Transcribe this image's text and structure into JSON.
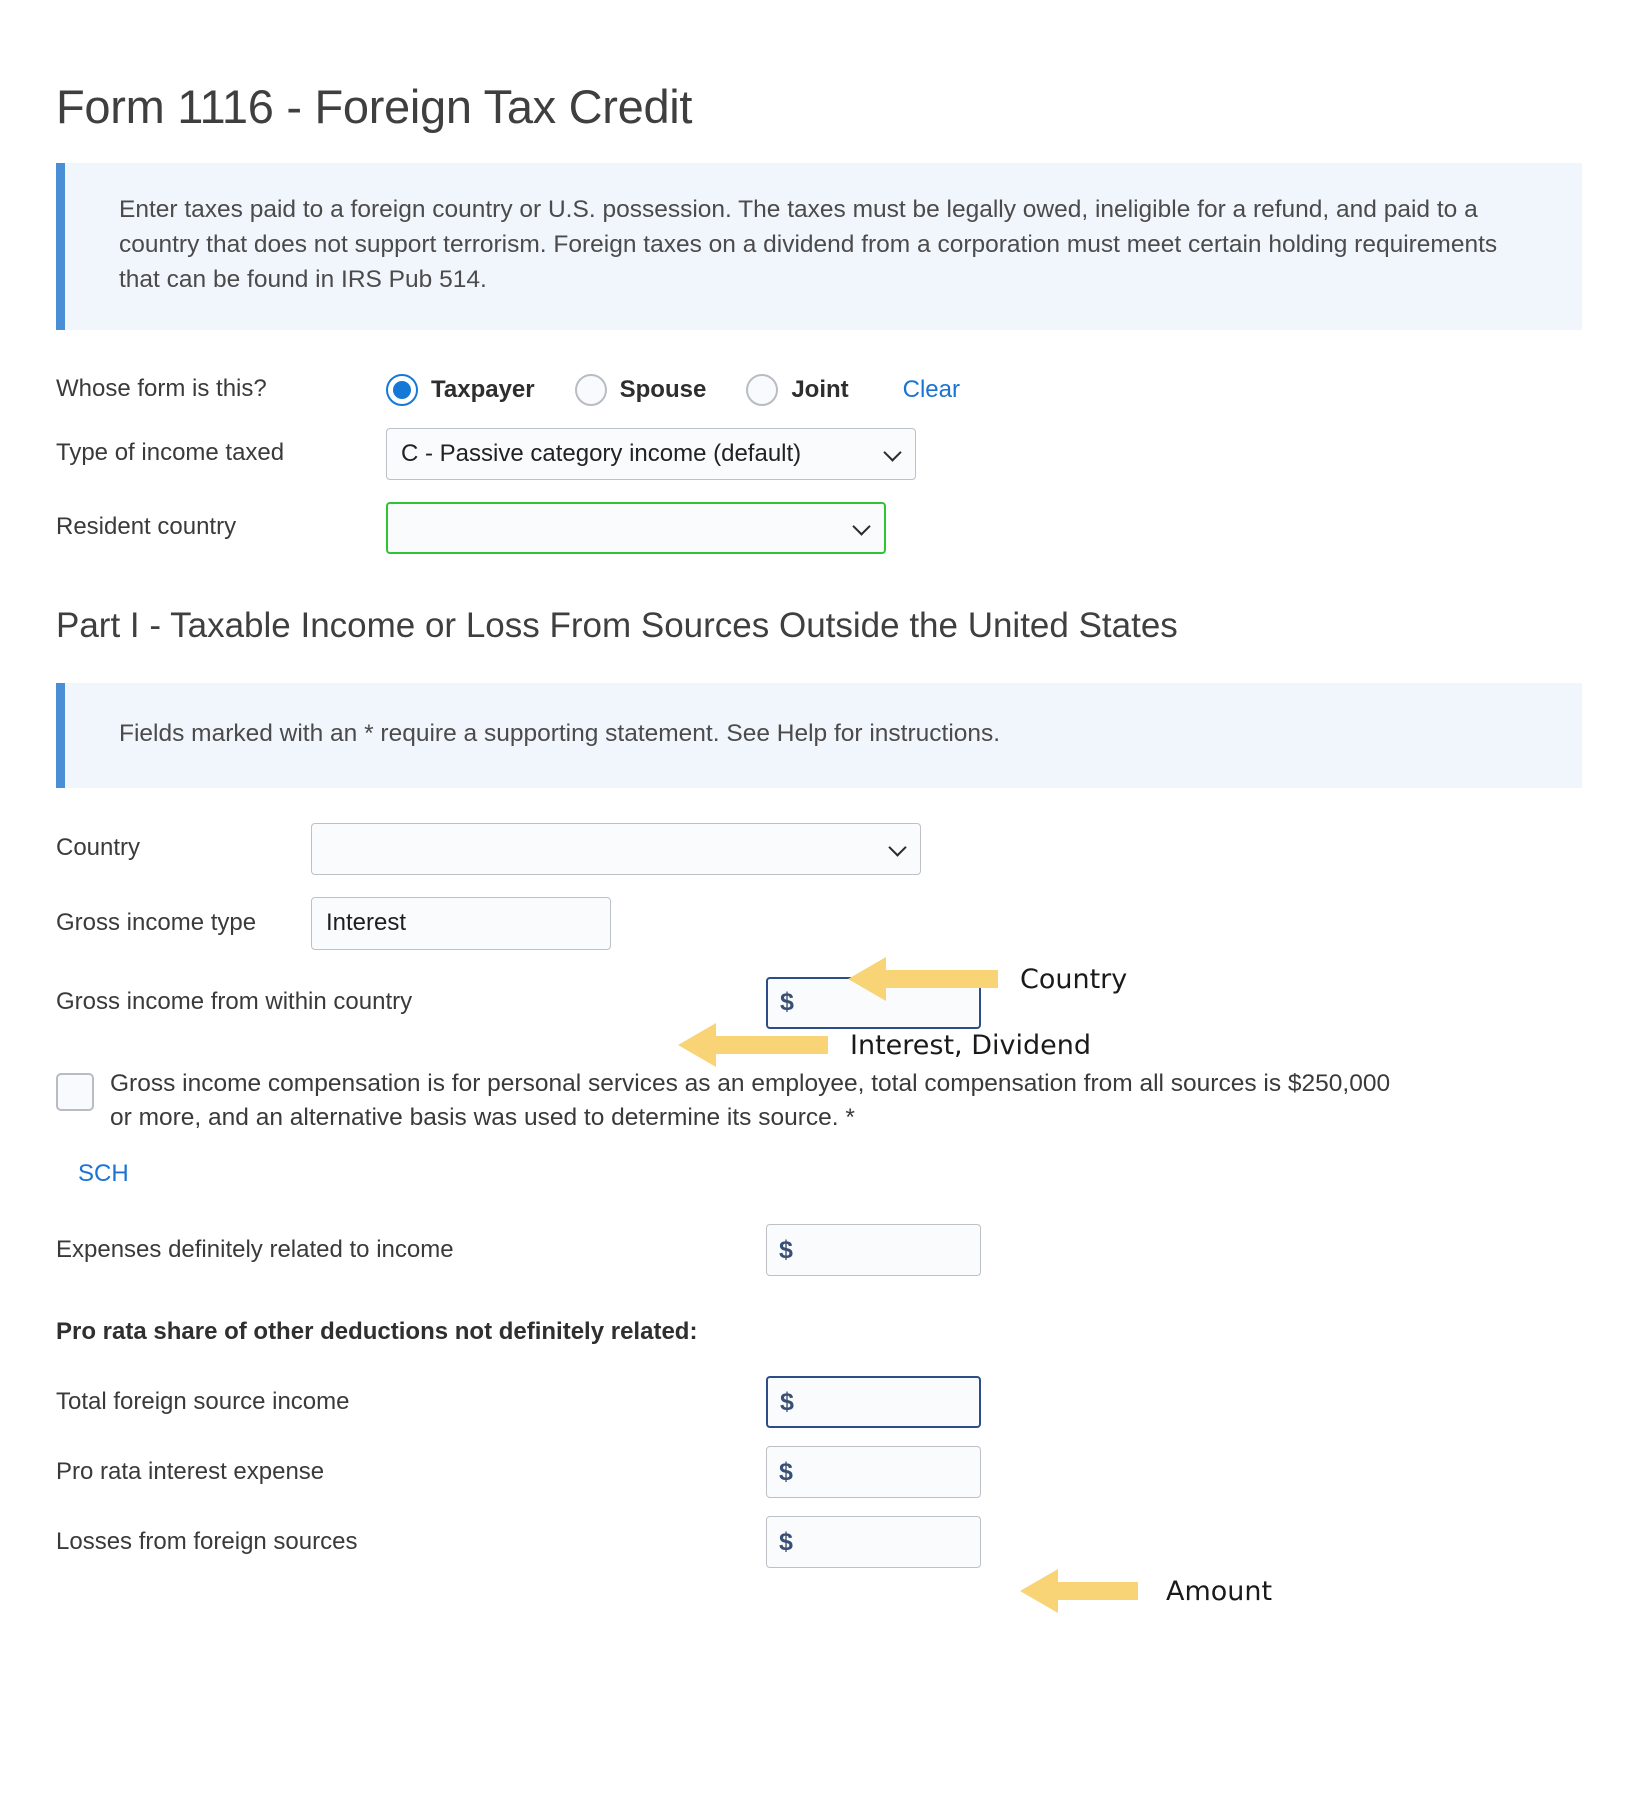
{
  "page": {
    "title": "Form 1116 - Foreign Tax Credit"
  },
  "info_banner": {
    "text": "Enter taxes paid to a foreign country or U.S. possession. The taxes must be legally owed, ineligible for a refund, and paid to a country that does not support terrorism. Foreign taxes on a dividend from a corporation must meet certain holding requirements that can be found in IRS Pub 514."
  },
  "whose_form": {
    "label": "Whose form is this?",
    "options": [
      {
        "label": "Taxpayer",
        "selected": true
      },
      {
        "label": "Spouse",
        "selected": false
      },
      {
        "label": "Joint",
        "selected": false
      }
    ],
    "clear_label": "Clear"
  },
  "income_type": {
    "label": "Type of income taxed",
    "value": "C - Passive category income (default)"
  },
  "resident_country": {
    "label": "Resident country",
    "value": ""
  },
  "part_one": {
    "heading": "Part I - Taxable Income or Loss From Sources Outside the United States",
    "note_banner": "Fields marked with an * require a supporting statement. See Help for instructions.",
    "country": {
      "label": "Country",
      "value": ""
    },
    "gross_income_type": {
      "label": "Gross income type",
      "value": "Interest"
    },
    "gross_income_within": {
      "label": "Gross income from within country",
      "currency_symbol": "$",
      "value": ""
    },
    "compensation_checkbox": {
      "text": "Gross income compensation is for personal services as an employee, total compensation from all sources is $250,000 or more, and an alternative basis was used to determine its source. *",
      "checked": false
    },
    "sch_link": "SCH",
    "expenses_related": {
      "label": "Expenses definitely related to income",
      "currency_symbol": "$",
      "value": ""
    },
    "pro_rata_heading": "Pro rata share of other deductions not definitely related:",
    "total_foreign_income": {
      "label": "Total foreign source income",
      "currency_symbol": "$",
      "value": ""
    },
    "pro_rata_interest": {
      "label": "Pro rata interest expense",
      "currency_symbol": "$",
      "value": ""
    },
    "losses_foreign": {
      "label": "Losses from foreign sources",
      "currency_symbol": "$",
      "value": ""
    }
  },
  "annotations": [
    {
      "text": "Country"
    },
    {
      "text": "Interest,  Dividend"
    },
    {
      "text": "Amount"
    }
  ],
  "colors": {
    "accent_blue": "#1a73d4",
    "banner_bg": "#f1f6fd",
    "banner_bar": "#4a8fd6",
    "focus_green": "#2fc435",
    "focus_navy": "#2c4d85",
    "annotation_arrow": "#f9d477"
  }
}
